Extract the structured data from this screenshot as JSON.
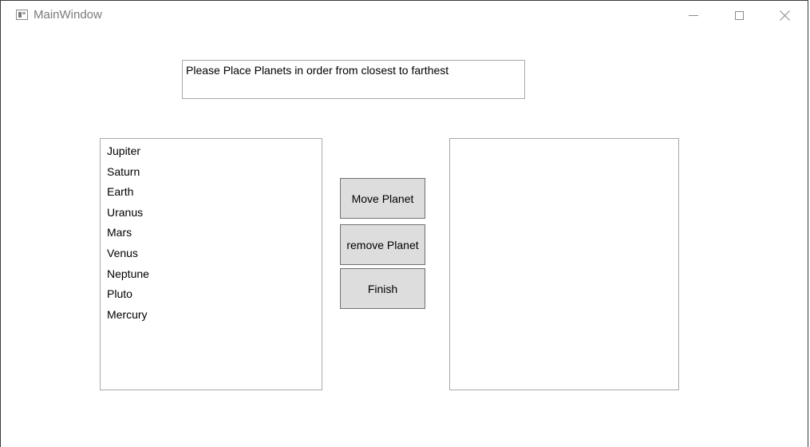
{
  "window": {
    "title": "MainWindow",
    "icon": "app-window-icon"
  },
  "caption_buttons": {
    "minimize_icon": "minimize-icon",
    "maximize_icon": "maximize-icon",
    "close_icon": "close-icon"
  },
  "instruction": {
    "text": "Please Place Planets in order from closest to farthest"
  },
  "source_list": {
    "items": [
      "Jupiter",
      "Saturn",
      "Earth",
      "Uranus",
      "Mars",
      "Venus",
      "Neptune",
      "Pluto",
      "Mercury"
    ]
  },
  "target_list": {
    "items": []
  },
  "buttons": {
    "move": "Move Planet",
    "remove": "remove Planet",
    "finish": "Finish"
  },
  "colors": {
    "button_bg": "#dddddd",
    "button_border": "#707070",
    "box_border": "#a9a9a9",
    "title_text": "#7a7a7a"
  }
}
